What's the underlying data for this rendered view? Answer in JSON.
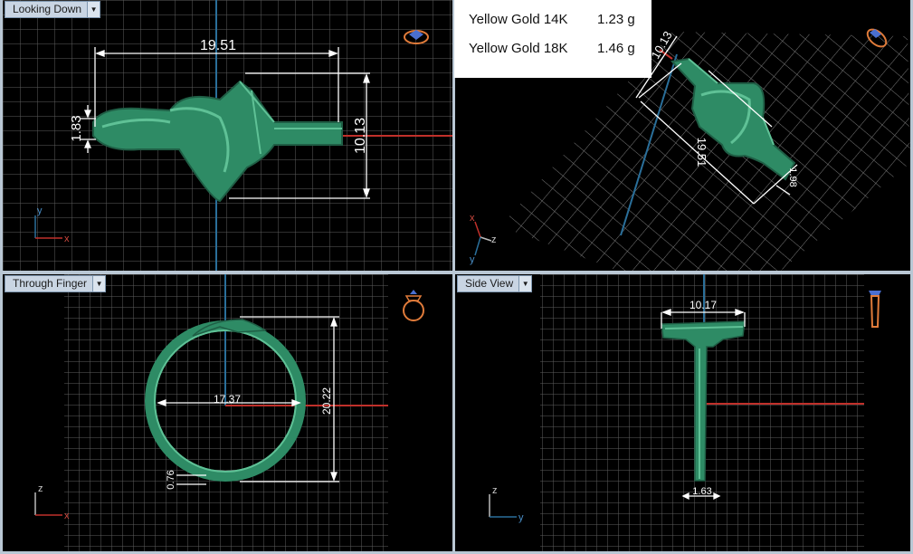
{
  "viewports": {
    "top_left": {
      "label": "Looking Down",
      "dims": {
        "width": "19.51",
        "height": "10.13",
        "thickness": "1.83"
      },
      "axes": {
        "vertical": "y",
        "horizontal": "x"
      }
    },
    "top_right": {
      "dims": {
        "width": "19.51",
        "height": "10.13",
        "thickness": "1.98"
      },
      "axes": {
        "a": "x",
        "b": "z",
        "c": "y"
      }
    },
    "bottom_left": {
      "label": "Through Finger",
      "dims": {
        "diameter": "17.37",
        "outer_height": "20.22",
        "band": "0.76"
      },
      "axes": {
        "vertical": "z",
        "horizontal": "x"
      }
    },
    "bottom_right": {
      "label": "Side View",
      "dims": {
        "top_width": "10.17",
        "shank": "1.63"
      },
      "axes": {
        "vertical": "z",
        "horizontal": "y"
      }
    }
  },
  "weights": [
    {
      "metal": "Yellow Gold 14K",
      "weight": "1.23 g"
    },
    {
      "metal": "Yellow Gold 18K",
      "weight": "1.46 g"
    }
  ],
  "icons": {
    "view_cube": "ring-orientation-icon",
    "dropdown": "chevron-down-icon"
  },
  "colors": {
    "model": "#2e8b65",
    "grid": "#6f6f6f",
    "x_axis": "#c0302a",
    "y_axis": "#2a6f9a",
    "dimension": "#ffffff",
    "icon_orange": "#e07b3a",
    "icon_blue": "#4a6fd0"
  }
}
